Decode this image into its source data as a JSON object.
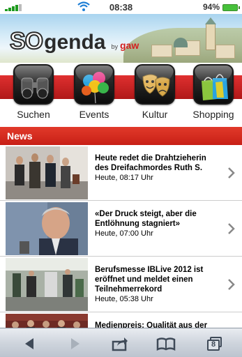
{
  "status_bar": {
    "time": "08:38",
    "battery_percent": "94%"
  },
  "header": {
    "logo_so": "SO",
    "logo_genda": "genda",
    "logo_by": "by",
    "logo_gaw": "gaw"
  },
  "categories": [
    {
      "label": "Suchen",
      "icon": "binoculars-icon"
    },
    {
      "label": "Events",
      "icon": "balloons-icon"
    },
    {
      "label": "Kultur",
      "icon": "theater-masks-icon"
    },
    {
      "label": "Shopping",
      "icon": "shopping-bags-icon"
    }
  ],
  "news": {
    "heading": "News",
    "items": [
      {
        "title": "Heute redet die Drahtzieherin des Dreifachmordes Ruth S.",
        "time": "Heute, 08:17 Uhr"
      },
      {
        "title": "«Der Druck steigt, aber die Entlöhnung stagniert»",
        "time": "Heute, 07:00 Uhr"
      },
      {
        "title": "Berufsmesse IBLive 2012 ist eröffnet und meldet einen Teilnehmerrekord",
        "time": "Heute, 05:38 Uhr"
      },
      {
        "title": "Medienpreis: Qualität aus der Region für die Region",
        "time": ""
      }
    ]
  },
  "toolbar": {
    "tabs_count": "8",
    "accent": "#c81f16"
  }
}
